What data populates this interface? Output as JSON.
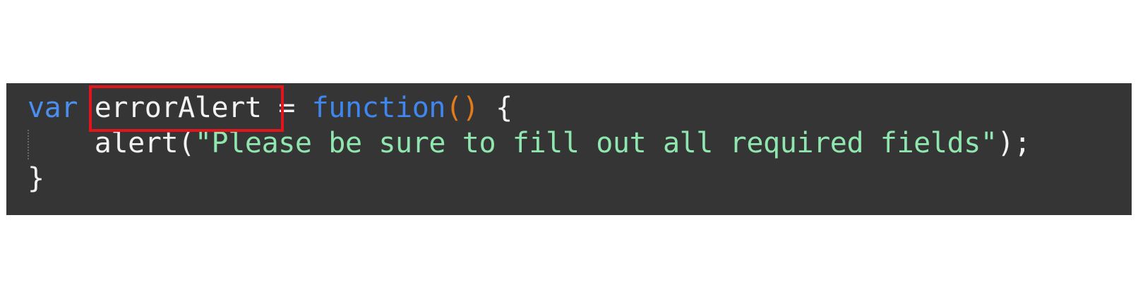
{
  "code": {
    "line1": {
      "keyword": "var",
      "identifier": "errorAlert",
      "operator": "=",
      "function_keyword": "function",
      "parens": "()",
      "open_brace": "{"
    },
    "line2": {
      "indent": "    ",
      "call_name": "alert",
      "open_paren": "(",
      "string": "\"Please be sure to fill out all required fields\"",
      "close": ");"
    },
    "line3": {
      "close_brace": "}"
    }
  },
  "highlight": {
    "target": "errorAlert",
    "color": "#e3141c"
  },
  "colors": {
    "editor_background": "#353535",
    "keyword": "#4a8ff0",
    "identifier": "#f2f2f2",
    "paren": "#e07c1c",
    "string": "#8fe6ae"
  }
}
